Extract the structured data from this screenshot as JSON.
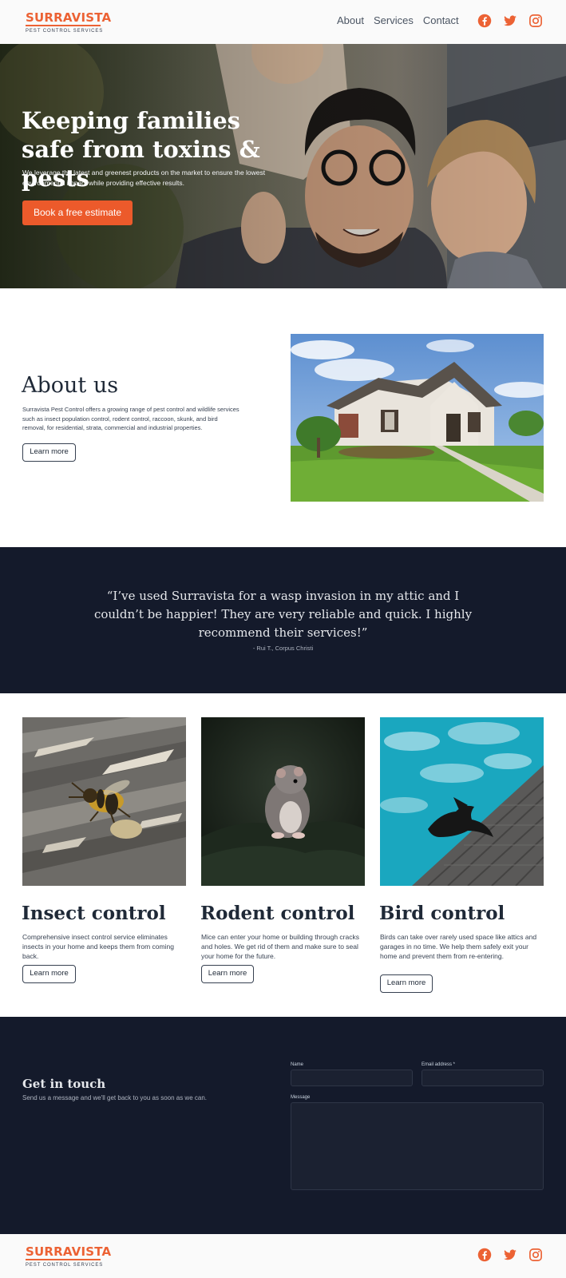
{
  "brand": {
    "name": "SURRAVISTA",
    "tagline": "PEST CONTROL SERVICES",
    "accent_color": "#ec6234",
    "dark_color": "#141a2b"
  },
  "nav": {
    "items": [
      "About",
      "Services",
      "Contact"
    ]
  },
  "socials": [
    "facebook-icon",
    "twitter-icon",
    "instagram-icon"
  ],
  "hero": {
    "title": "Keeping families safe from toxins & pests",
    "text": "We leverage the latest and greenest products on the market to ensure the lowest environmental impact while providing effective results.",
    "cta": "Book a free estimate"
  },
  "about": {
    "title": "About us",
    "text": "Surravista Pest Control offers a growing range of pest control and wildlife services such as insect population control, rodent control, raccoon, skunk, and bird removal, for residential, strata, commercial and industrial properties.",
    "cta": "Learn more"
  },
  "testimonial": {
    "quote": "“I’ve used Surravista for a wasp invasion in my attic and I couldn’t be happier! They are very reliable and quick. I highly recommend their services!”",
    "author": "- Rui T., Corpus Christi"
  },
  "services": [
    {
      "title": "Insect control",
      "text": "Comprehensive insect control service eliminates insects in your home and keeps them from coming back.",
      "cta": "Learn more"
    },
    {
      "title": "Rodent control",
      "text": "Mice can enter your home or building through cracks and holes. We get rid of them and make sure to seal your home for the future.",
      "cta": "Learn more"
    },
    {
      "title": "Bird control",
      "text": "Birds can take over rarely used space like attics and garages in no time. We help them safely exit your home and prevent them from re-entering.",
      "cta": "Learn more"
    }
  ],
  "contact": {
    "title": "Get in touch",
    "text": "Send us a message and we'll get back to you as soon as we can.",
    "name_label": "Name",
    "name_value": "",
    "email_label": "Email address *",
    "email_value": "",
    "message_label": "Message",
    "message_value": ""
  }
}
